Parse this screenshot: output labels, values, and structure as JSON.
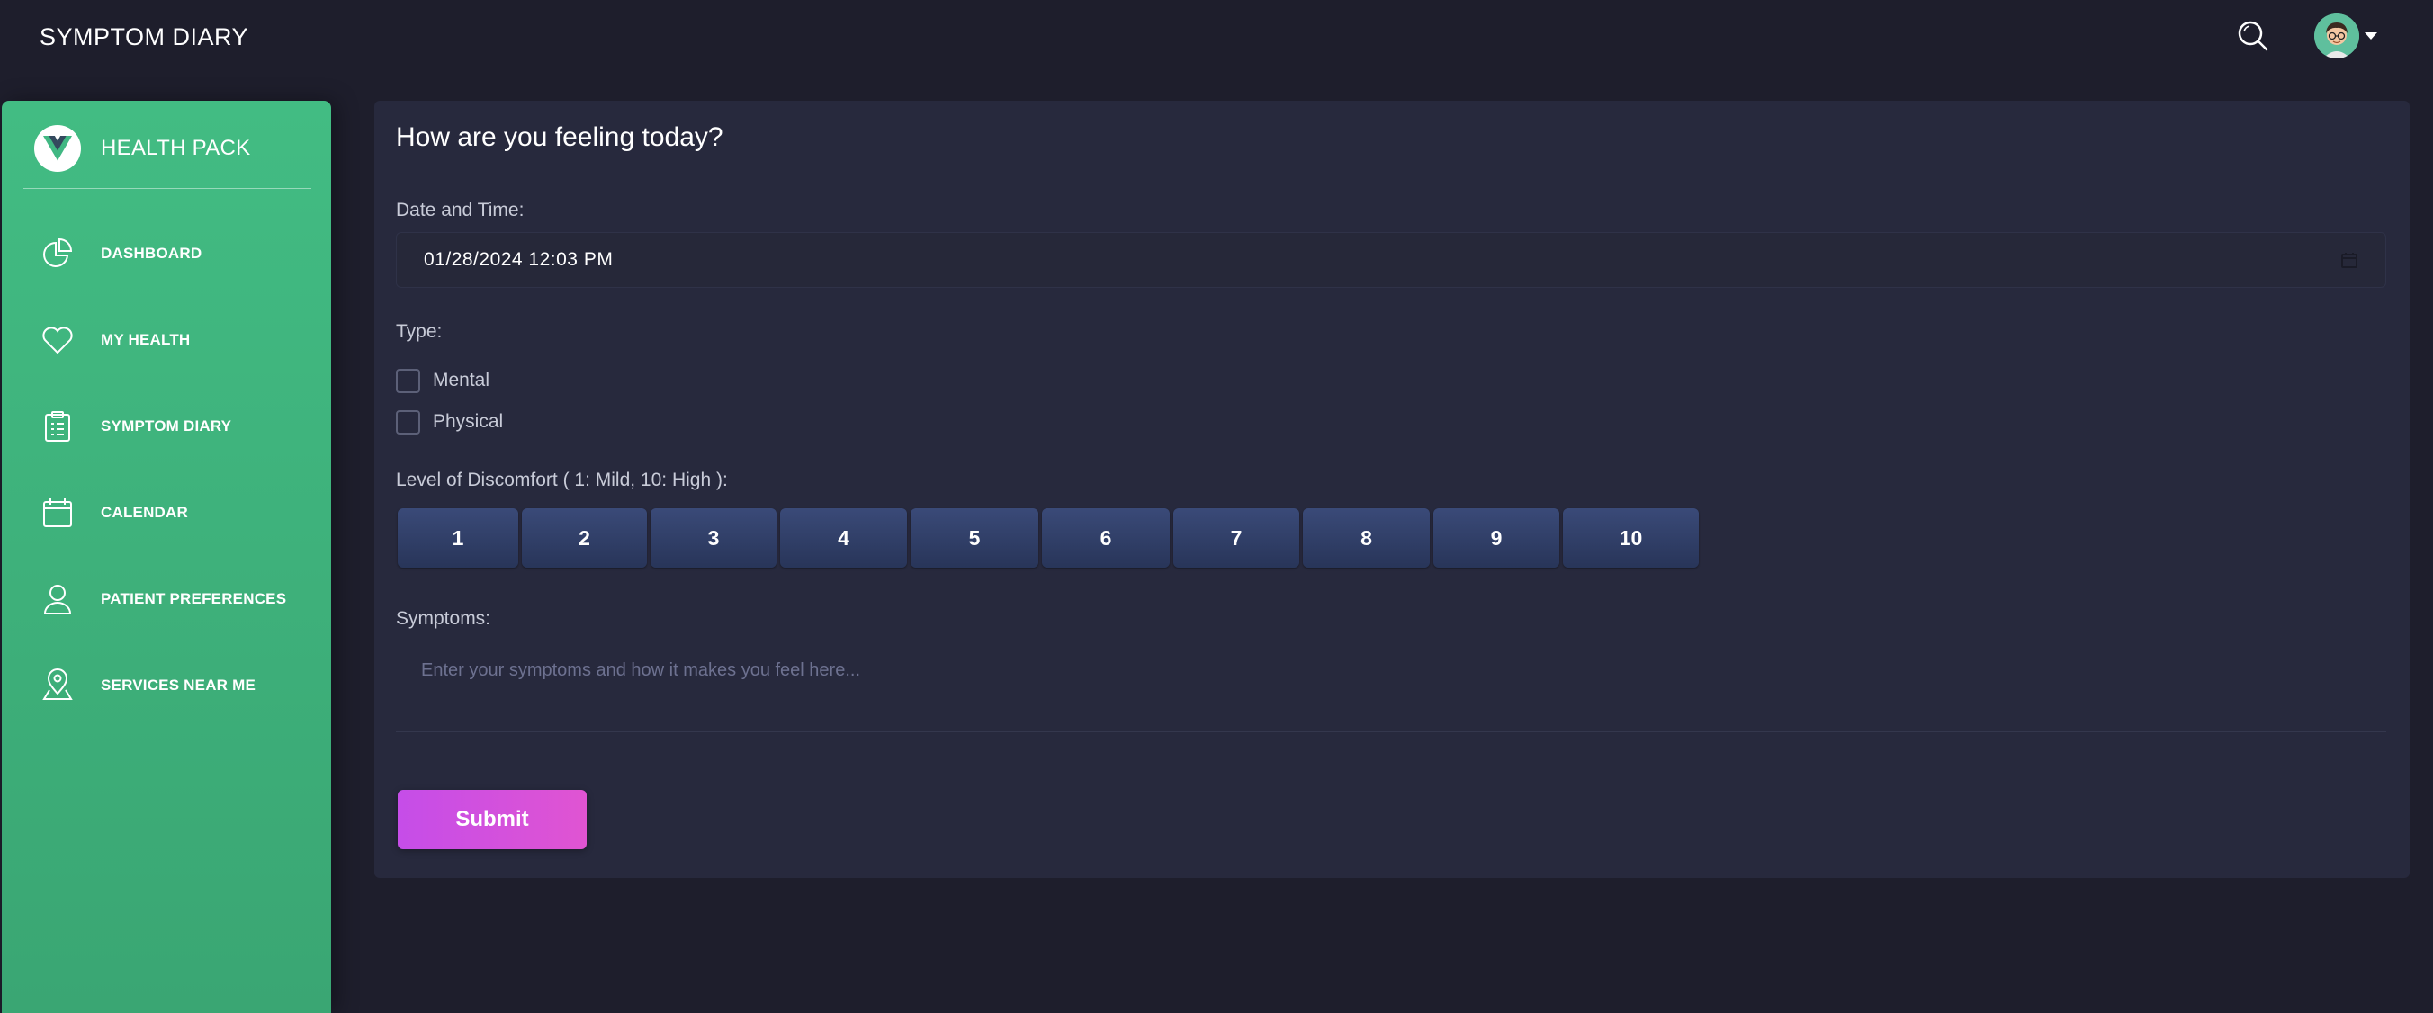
{
  "header": {
    "title": "SYMPTOM DIARY",
    "search_icon": "search-icon",
    "avatar_icon": "user-avatar"
  },
  "sidebar": {
    "brand": "HEALTH PACK",
    "items": [
      {
        "label": "DASHBOARD",
        "icon": "pie-chart-icon"
      },
      {
        "label": "MY HEALTH",
        "icon": "heart-icon"
      },
      {
        "label": "SYMPTOM DIARY",
        "icon": "clipboard-icon"
      },
      {
        "label": "CALENDAR",
        "icon": "calendar-icon"
      },
      {
        "label": "PATIENT PREFERENCES",
        "icon": "user-icon"
      },
      {
        "label": "SERVICES NEAR ME",
        "icon": "location-pin-icon"
      }
    ]
  },
  "form": {
    "title": "How are you feeling today?",
    "datetime_label": "Date and Time:",
    "datetime_value": "01/28/2024 12:03 PM",
    "type_label": "Type:",
    "types": [
      "Mental",
      "Physical"
    ],
    "discomfort_label": "Level of Discomfort ( 1: Mild, 10: High ):",
    "levels": [
      "1",
      "2",
      "3",
      "4",
      "5",
      "6",
      "7",
      "8",
      "9",
      "10"
    ],
    "symptoms_label": "Symptoms:",
    "symptoms_placeholder": "Enter your symptoms and how it makes you feel here...",
    "submit_label": "Submit"
  },
  "colors": {
    "sidebar_green": "#42bc83",
    "panel_bg": "#27293d",
    "page_bg": "#1e1e2c",
    "level_button": "#33426b",
    "submit_button": "#d24fe0"
  }
}
